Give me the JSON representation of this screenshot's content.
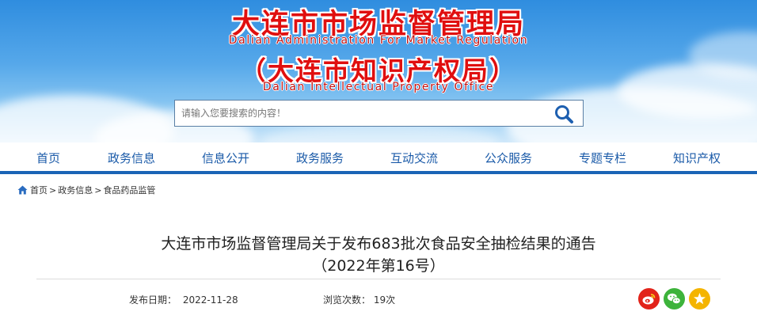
{
  "banner": {
    "title_cn": "大连市市场监督管理局",
    "title_en": "Dalian Administration For Market Regulation",
    "subtitle_cn": "（大连市知识产权局）",
    "subtitle_en": "Dalian Intellectual Property Office"
  },
  "search": {
    "placeholder": "请输入您要搜索的内容！",
    "icon": "search-icon"
  },
  "nav": {
    "items": [
      {
        "label": "首页"
      },
      {
        "label": "政务信息"
      },
      {
        "label": "信息公开"
      },
      {
        "label": "政务服务"
      },
      {
        "label": "互动交流"
      },
      {
        "label": "公众服务"
      },
      {
        "label": "专题专栏"
      },
      {
        "label": "知识产权"
      }
    ],
    "accent": "#1a64b6"
  },
  "breadcrumb": {
    "icon": "home-icon",
    "items": [
      "首页",
      "政务信息",
      "食品药品监管"
    ],
    "separator": ">"
  },
  "article": {
    "title_line1": "大连市市场监督管理局关于发布683批次食品安全抽检结果的通告",
    "title_line2": "（2022年第16号）",
    "date_label": "发布日期：",
    "date_value": "2022-11-28",
    "views_label": "浏览次数：",
    "views_value": "19次"
  },
  "share": {
    "weibo_icon": "weibo-icon",
    "wechat_icon": "wechat-icon",
    "favorite_icon": "star-icon",
    "colors": {
      "weibo": "#e2231a",
      "wechat": "#3db33b",
      "favorite": "#f4b400"
    }
  }
}
